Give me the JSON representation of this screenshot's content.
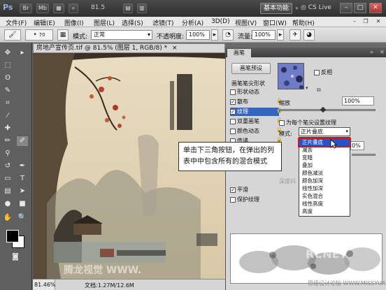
{
  "titlebar": {
    "logo": "Ps",
    "buttons": [
      "Br",
      "Mb"
    ],
    "zoom": "81.5",
    "workspace": "基本功能",
    "cs_live": "CS Live",
    "controls": [
      "–",
      "□",
      "✕"
    ]
  },
  "menubar": {
    "items": [
      "文件(F)",
      "编辑(E)",
      "图像(I)",
      "图层(L)",
      "选择(S)",
      "滤镜(T)",
      "分析(A)",
      "3D(D)",
      "视图(V)",
      "窗口(W)",
      "帮助(H)"
    ]
  },
  "options": {
    "brush_size": "70",
    "mode_label": "模式:",
    "mode_value": "正常",
    "opacity_label": "不透明度:",
    "opacity_value": "100%",
    "flow_label": "流量:",
    "flow_value": "100%"
  },
  "document": {
    "tab_title": "房地产宣传页.tif @ 81.5% (图层 1, RGB/8) *",
    "close": "×",
    "status_zoom": "81.46%",
    "status_doc": "文档:1.27M/12.6M"
  },
  "panel": {
    "tab": "画笔",
    "preset_button": "画笔预设",
    "tip_shape": "画笔笔尖形状",
    "options": [
      {
        "label": "形状动态",
        "checked": false
      },
      {
        "label": "散布",
        "checked": true
      },
      {
        "label": "纹理",
        "checked": true
      },
      {
        "label": "双重画笔",
        "checked": false
      },
      {
        "label": "颜色动态",
        "checked": false
      },
      {
        "label": "传递",
        "checked": false
      },
      {
        "label": "杂色",
        "checked": false
      },
      {
        "label": "湿边",
        "checked": false
      },
      {
        "label": "喷枪",
        "checked": false
      },
      {
        "label": "平滑",
        "checked": true
      },
      {
        "label": "保护纹理",
        "checked": false
      }
    ],
    "invert_label": "反相",
    "scale_label": "缩放",
    "scale_value": "100%",
    "each_tip_label": "为每个笔尖设置纹理",
    "mode_label": "模式:",
    "mode_value": "正片叠底",
    "depth_partial": "深度抖",
    "field_partial": "0%",
    "blend_modes": [
      "正片叠底",
      "减去",
      "变暗",
      "叠加",
      "颜色减淡",
      "颜色加深",
      "线性加深",
      "实色混合",
      "线性高度",
      "高度"
    ]
  },
  "callout": {
    "line1": "单击下三角按钮，在弹出的列",
    "line2": "表中中包含所有的混合模式"
  },
  "watermarks": {
    "left": "腾龙视觉 WWW.",
    "right": "RCNET",
    "site": "思缘设计论坛 WWW.MISSYUAN.COM"
  },
  "colors": {
    "selection": "#2255cc",
    "highlight": "#dd1111",
    "panel_bg": "#d6d6d6"
  }
}
